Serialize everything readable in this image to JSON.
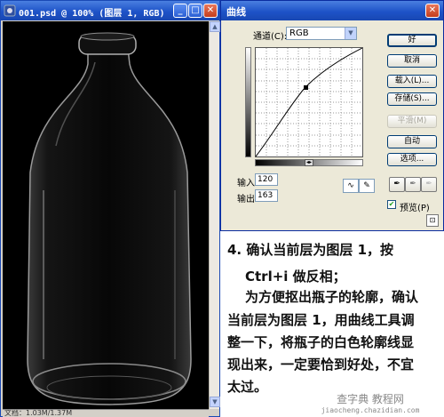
{
  "image_window": {
    "title": "001.psd @ 100% (图层 1, RGB)",
    "buttons": {
      "minimize": "_",
      "maximize": "□",
      "close": "✕"
    },
    "status_text": "文档：1.03M/1.37M"
  },
  "curves_dialog": {
    "title": "曲线",
    "channel_label": "通道(C):",
    "channel_value": "RGB",
    "input_label": "输入:",
    "input_value": "120",
    "output_label": "输出:",
    "output_value": "163",
    "buttons": {
      "ok": "好",
      "cancel": "取消",
      "load": "载入(L)...",
      "save": "存储(S)...",
      "smooth": "平滑(M)",
      "auto": "自动",
      "options": "选项..."
    },
    "preview_label": "预览(P)",
    "preview_checked": true
  },
  "instructions": {
    "lines": [
      "4. 确认当前层为图层 1，按",
      "Ctrl+i 做反相；",
      "为方便抠出瓶子的轮廓，确认",
      "当前层为图层 1，用曲线工具调",
      "整一下，将瓶子的白色轮廓线显",
      "现出来，一定要恰到好处，不宜",
      "太过。"
    ]
  },
  "watermark": {
    "main": "查字典 教程网",
    "sub": "jiaocheng.chazidian.com"
  }
}
